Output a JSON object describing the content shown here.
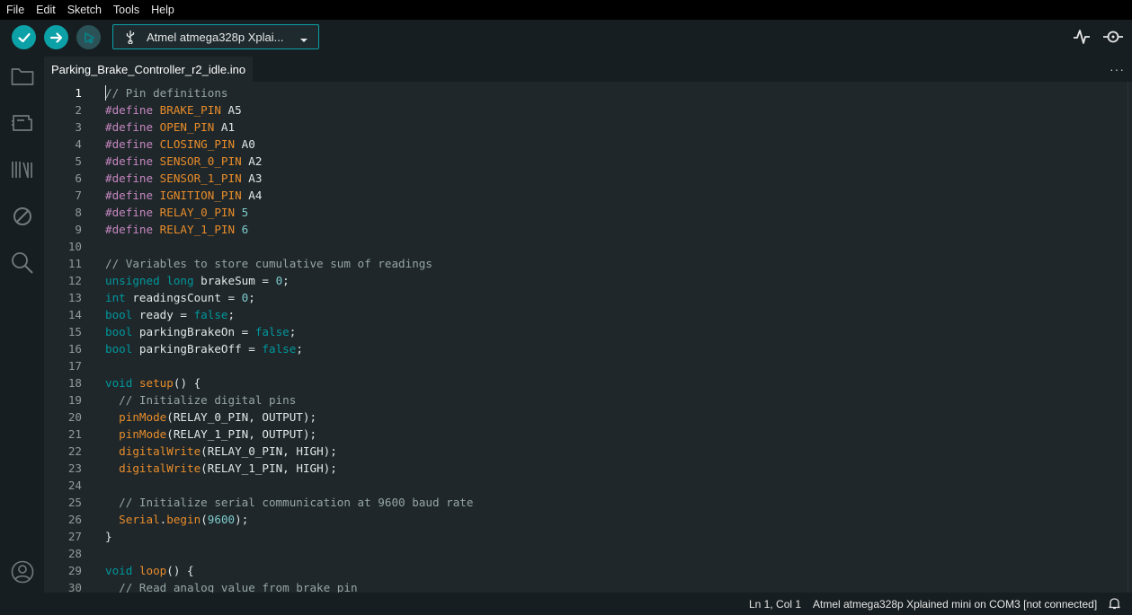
{
  "menu": [
    "File",
    "Edit",
    "Sketch",
    "Tools",
    "Help"
  ],
  "toolbar": {
    "board_label": "Atmel atmega328p Xplai...",
    "verify_icon": "checkmark-icon",
    "upload_icon": "arrow-right-icon",
    "debug_icon": "debug-play-icon",
    "serial_plotter_icon": "pulse-icon",
    "serial_monitor_icon": "magnifier-icon"
  },
  "sidebar": [
    "folder-icon",
    "board-icon",
    "library-icon",
    "debug-disabled-icon",
    "search-icon",
    "account-icon"
  ],
  "tab": {
    "filename": "Parking_Brake_Controller_r2_idle.ino",
    "more": "···"
  },
  "editor": {
    "active_line": 1,
    "lines": [
      [
        [
          "c",
          "// Pin definitions"
        ]
      ],
      [
        [
          "p",
          "#define"
        ],
        [
          "x",
          " "
        ],
        [
          "n",
          "BRAKE_PIN"
        ],
        [
          "x",
          " A5"
        ]
      ],
      [
        [
          "p",
          "#define"
        ],
        [
          "x",
          " "
        ],
        [
          "n",
          "OPEN_PIN"
        ],
        [
          "x",
          " A1"
        ]
      ],
      [
        [
          "p",
          "#define"
        ],
        [
          "x",
          " "
        ],
        [
          "n",
          "CLOSING_PIN"
        ],
        [
          "x",
          " A0"
        ]
      ],
      [
        [
          "p",
          "#define"
        ],
        [
          "x",
          " "
        ],
        [
          "n",
          "SENSOR_0_PIN"
        ],
        [
          "x",
          " A2"
        ]
      ],
      [
        [
          "p",
          "#define"
        ],
        [
          "x",
          " "
        ],
        [
          "n",
          "SENSOR_1_PIN"
        ],
        [
          "x",
          " A3"
        ]
      ],
      [
        [
          "p",
          "#define"
        ],
        [
          "x",
          " "
        ],
        [
          "n",
          "IGNITION_PIN"
        ],
        [
          "x",
          " A4"
        ]
      ],
      [
        [
          "p",
          "#define"
        ],
        [
          "x",
          " "
        ],
        [
          "n",
          "RELAY_0_PIN"
        ],
        [
          "x",
          " "
        ],
        [
          "u",
          "5"
        ]
      ],
      [
        [
          "p",
          "#define"
        ],
        [
          "x",
          " "
        ],
        [
          "n",
          "RELAY_1_PIN"
        ],
        [
          "x",
          " "
        ],
        [
          "u",
          "6"
        ]
      ],
      [],
      [
        [
          "c",
          "// Variables to store cumulative sum of readings"
        ]
      ],
      [
        [
          "t",
          "unsigned long"
        ],
        [
          "x",
          " brakeSum = "
        ],
        [
          "u",
          "0"
        ],
        [
          "x",
          ";"
        ]
      ],
      [
        [
          "t",
          "int"
        ],
        [
          "x",
          " readingsCount = "
        ],
        [
          "u",
          "0"
        ],
        [
          "x",
          ";"
        ]
      ],
      [
        [
          "t",
          "bool"
        ],
        [
          "x",
          " ready = "
        ],
        [
          "t",
          "false"
        ],
        [
          "x",
          ";"
        ]
      ],
      [
        [
          "t",
          "bool"
        ],
        [
          "x",
          " parkingBrakeOn = "
        ],
        [
          "t",
          "false"
        ],
        [
          "x",
          ";"
        ]
      ],
      [
        [
          "t",
          "bool"
        ],
        [
          "x",
          " parkingBrakeOff = "
        ],
        [
          "t",
          "false"
        ],
        [
          "x",
          ";"
        ]
      ],
      [],
      [
        [
          "t",
          "void"
        ],
        [
          "x",
          " "
        ],
        [
          "f",
          "setup"
        ],
        [
          "x",
          "() {"
        ]
      ],
      [
        [
          "x",
          "  "
        ],
        [
          "c",
          "// Initialize digital pins"
        ]
      ],
      [
        [
          "x",
          "  "
        ],
        [
          "f",
          "pinMode"
        ],
        [
          "x",
          "(RELAY_0_PIN, OUTPUT);"
        ]
      ],
      [
        [
          "x",
          "  "
        ],
        [
          "f",
          "pinMode"
        ],
        [
          "x",
          "(RELAY_1_PIN, OUTPUT);"
        ]
      ],
      [
        [
          "x",
          "  "
        ],
        [
          "f",
          "digitalWrite"
        ],
        [
          "x",
          "(RELAY_0_PIN, HIGH);"
        ]
      ],
      [
        [
          "x",
          "  "
        ],
        [
          "f",
          "digitalWrite"
        ],
        [
          "x",
          "(RELAY_1_PIN, HIGH);"
        ]
      ],
      [],
      [
        [
          "x",
          "  "
        ],
        [
          "c",
          "// Initialize serial communication at 9600 baud rate"
        ]
      ],
      [
        [
          "x",
          "  "
        ],
        [
          "f",
          "Serial"
        ],
        [
          "x",
          "."
        ],
        [
          "f",
          "begin"
        ],
        [
          "x",
          "("
        ],
        [
          "u",
          "9600"
        ],
        [
          "x",
          ");"
        ]
      ],
      [
        [
          "x",
          "}"
        ]
      ],
      [],
      [
        [
          "t",
          "void"
        ],
        [
          "x",
          " "
        ],
        [
          "f",
          "loop"
        ],
        [
          "x",
          "() {"
        ]
      ],
      [
        [
          "x",
          "  "
        ],
        [
          "c",
          "// Read analog value from brake pin"
        ]
      ]
    ]
  },
  "status": {
    "position": "Ln 1, Col 1",
    "connection": "Atmel atmega328p Xplained mini on COM3 [not connected]",
    "bell_icon": "bell-icon"
  },
  "colors": {
    "accent": "#0ca1a6",
    "editor_bg": "#1f272a",
    "chrome_bg": "#171e21"
  }
}
